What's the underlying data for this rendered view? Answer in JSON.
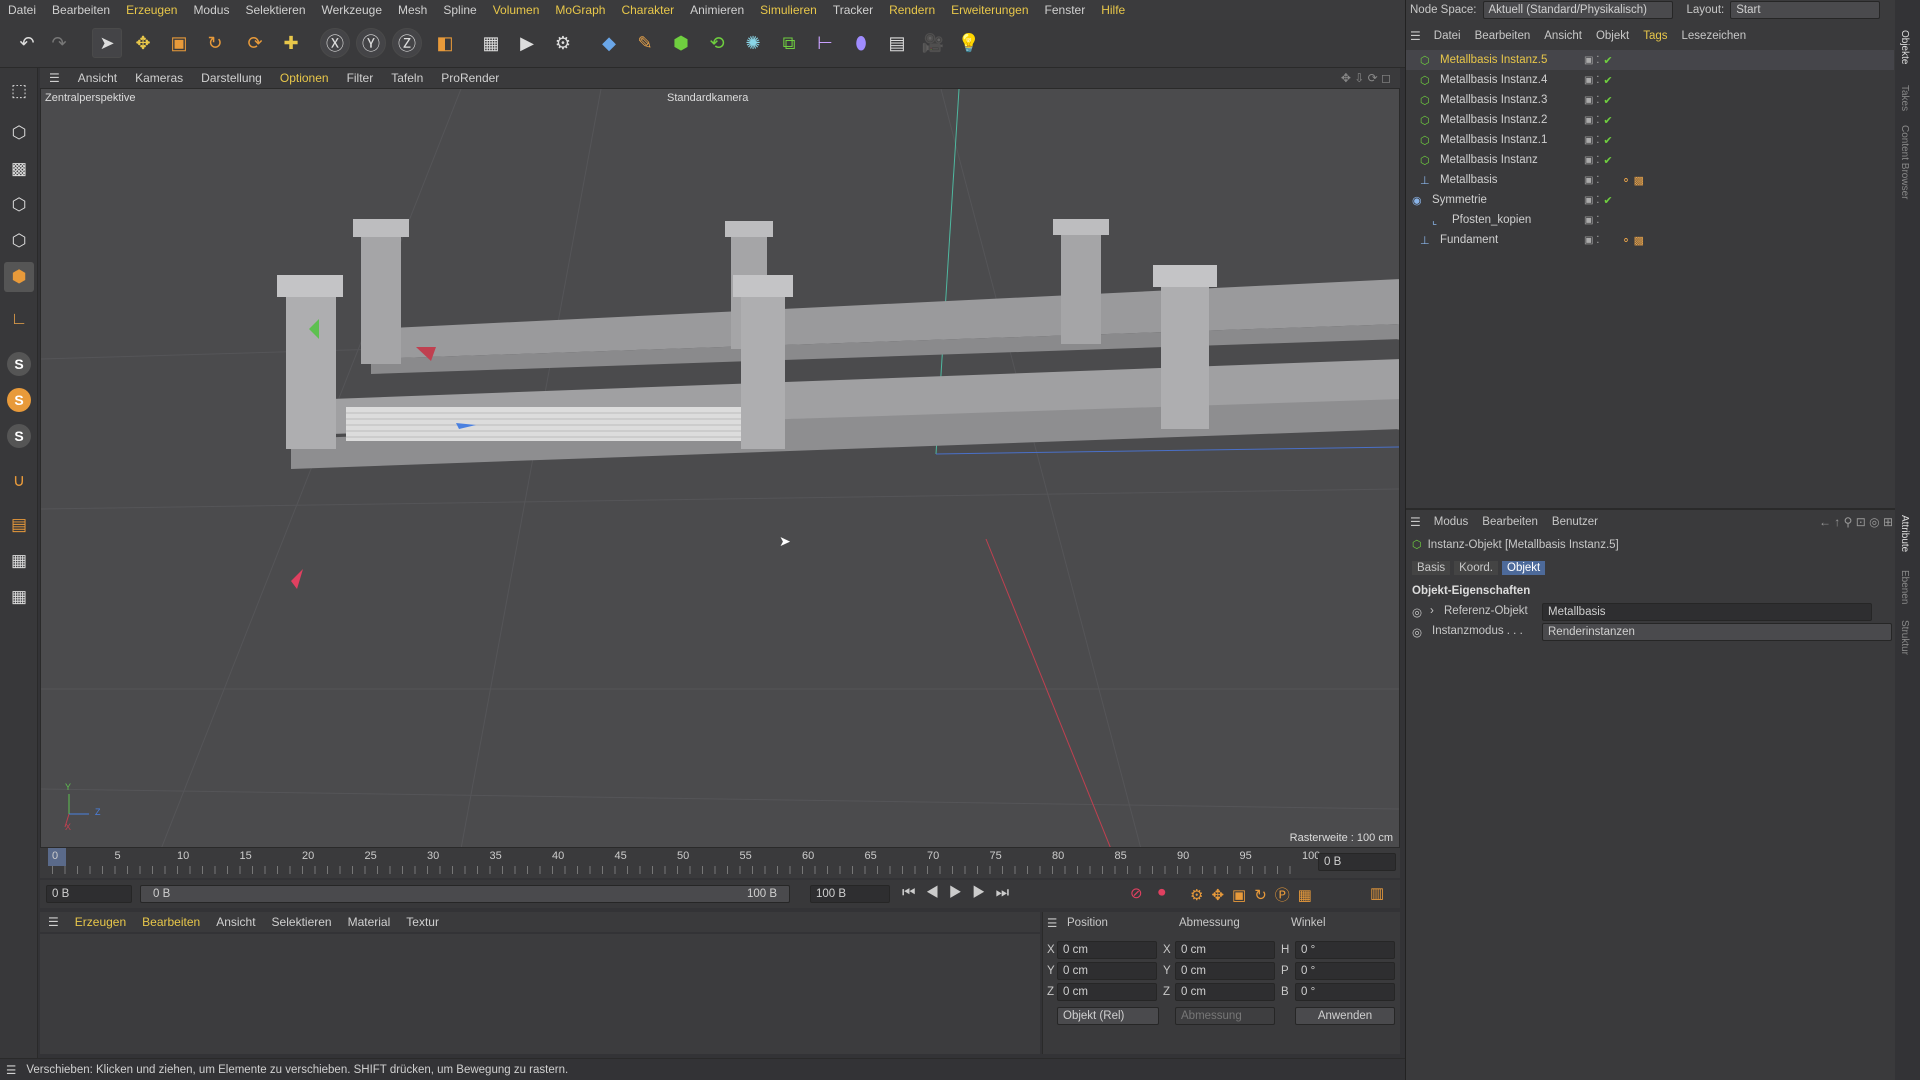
{
  "menubar": [
    "Datei",
    "Bearbeiten",
    "Erzeugen",
    "Modus",
    "Selektieren",
    "Werkzeuge",
    "Mesh",
    "Spline",
    "Volumen",
    "MoGraph",
    "Charakter",
    "Animieren",
    "Simulieren",
    "Tracker",
    "Rendern",
    "Erweiterungen",
    "Fenster",
    "Hilfe"
  ],
  "viewport": {
    "menu": [
      "Ansicht",
      "Kameras",
      "Darstellung",
      "Optionen",
      "Filter",
      "Tafeln",
      "ProRender"
    ],
    "menu_active": "Optionen",
    "label": "Zentralperspektive",
    "camera": "Standardkamera",
    "grid": "Rasterweite : 100 cm",
    "axis_y": "Y",
    "axis_z": "Z",
    "axis_x": "X"
  },
  "timeline": {
    "ticks": [
      "0",
      "5",
      "10",
      "15",
      "20",
      "25",
      "30",
      "35",
      "40",
      "45",
      "50",
      "55",
      "60",
      "65",
      "70",
      "75",
      "80",
      "85",
      "90",
      "95",
      "100"
    ],
    "current": "0 B"
  },
  "transport": {
    "start": "0 B",
    "range_start": "0 B",
    "range_end": "100 B",
    "end": "100 B"
  },
  "material": {
    "menu": [
      "Erzeugen",
      "Bearbeiten",
      "Ansicht",
      "Selektieren",
      "Material",
      "Textur"
    ]
  },
  "coords": {
    "h_position": "Position",
    "h_size": "Abmessung",
    "h_angle": "Winkel",
    "rows": [
      {
        "a": "X",
        "p": "0 cm",
        "b": "X",
        "s": "0 cm",
        "c": "H",
        "w": "0 °"
      },
      {
        "a": "Y",
        "p": "0 cm",
        "b": "Y",
        "s": "0 cm",
        "c": "P",
        "w": "0 °"
      },
      {
        "a": "Z",
        "p": "0 cm",
        "b": "Z",
        "s": "0 cm",
        "c": "B",
        "w": "0 °"
      }
    ],
    "mode": "Objekt (Rel)",
    "size_mode": "Abmessung",
    "apply": "Anwenden"
  },
  "status": "Verschieben: Klicken und ziehen, um Elemente zu verschieben. SHIFT drücken, um Bewegung zu rastern.",
  "nodespace": {
    "label": "Node Space:",
    "value": "Aktuell (Standard/Physikalisch)",
    "layout_label": "Layout:",
    "layout": "Start"
  },
  "objmenu": [
    "Datei",
    "Bearbeiten",
    "Ansicht",
    "Objekt",
    "Tags",
    "Lesezeichen"
  ],
  "objects": [
    {
      "name": "Metallbasis Instanz.5",
      "selected": true
    },
    {
      "name": "Metallbasis Instanz.4"
    },
    {
      "name": "Metallbasis Instanz.3"
    },
    {
      "name": "Metallbasis Instanz.2"
    },
    {
      "name": "Metallbasis Instanz.1"
    },
    {
      "name": "Metallbasis Instanz"
    },
    {
      "name": "Metallbasis"
    },
    {
      "name": "Symmetrie"
    },
    {
      "name": "Pfosten_kopien"
    },
    {
      "name": "Fundament"
    }
  ],
  "attr": {
    "menu": [
      "Modus",
      "Bearbeiten",
      "Benutzer"
    ],
    "title": "Instanz-Objekt [Metallbasis Instanz.5]",
    "tabs": [
      "Basis",
      "Koord.",
      "Objekt"
    ],
    "section": "Objekt-Eigenschaften",
    "ref_label": "Referenz-Objekt",
    "ref_value": "Metallbasis",
    "mode_label": "Instanzmodus . . .",
    "mode_value": "Renderinstanzen"
  },
  "sidebar": [
    "Objekte",
    "Takes",
    "Content Browser",
    "Attribute",
    "Ebenen",
    "Struktur"
  ]
}
